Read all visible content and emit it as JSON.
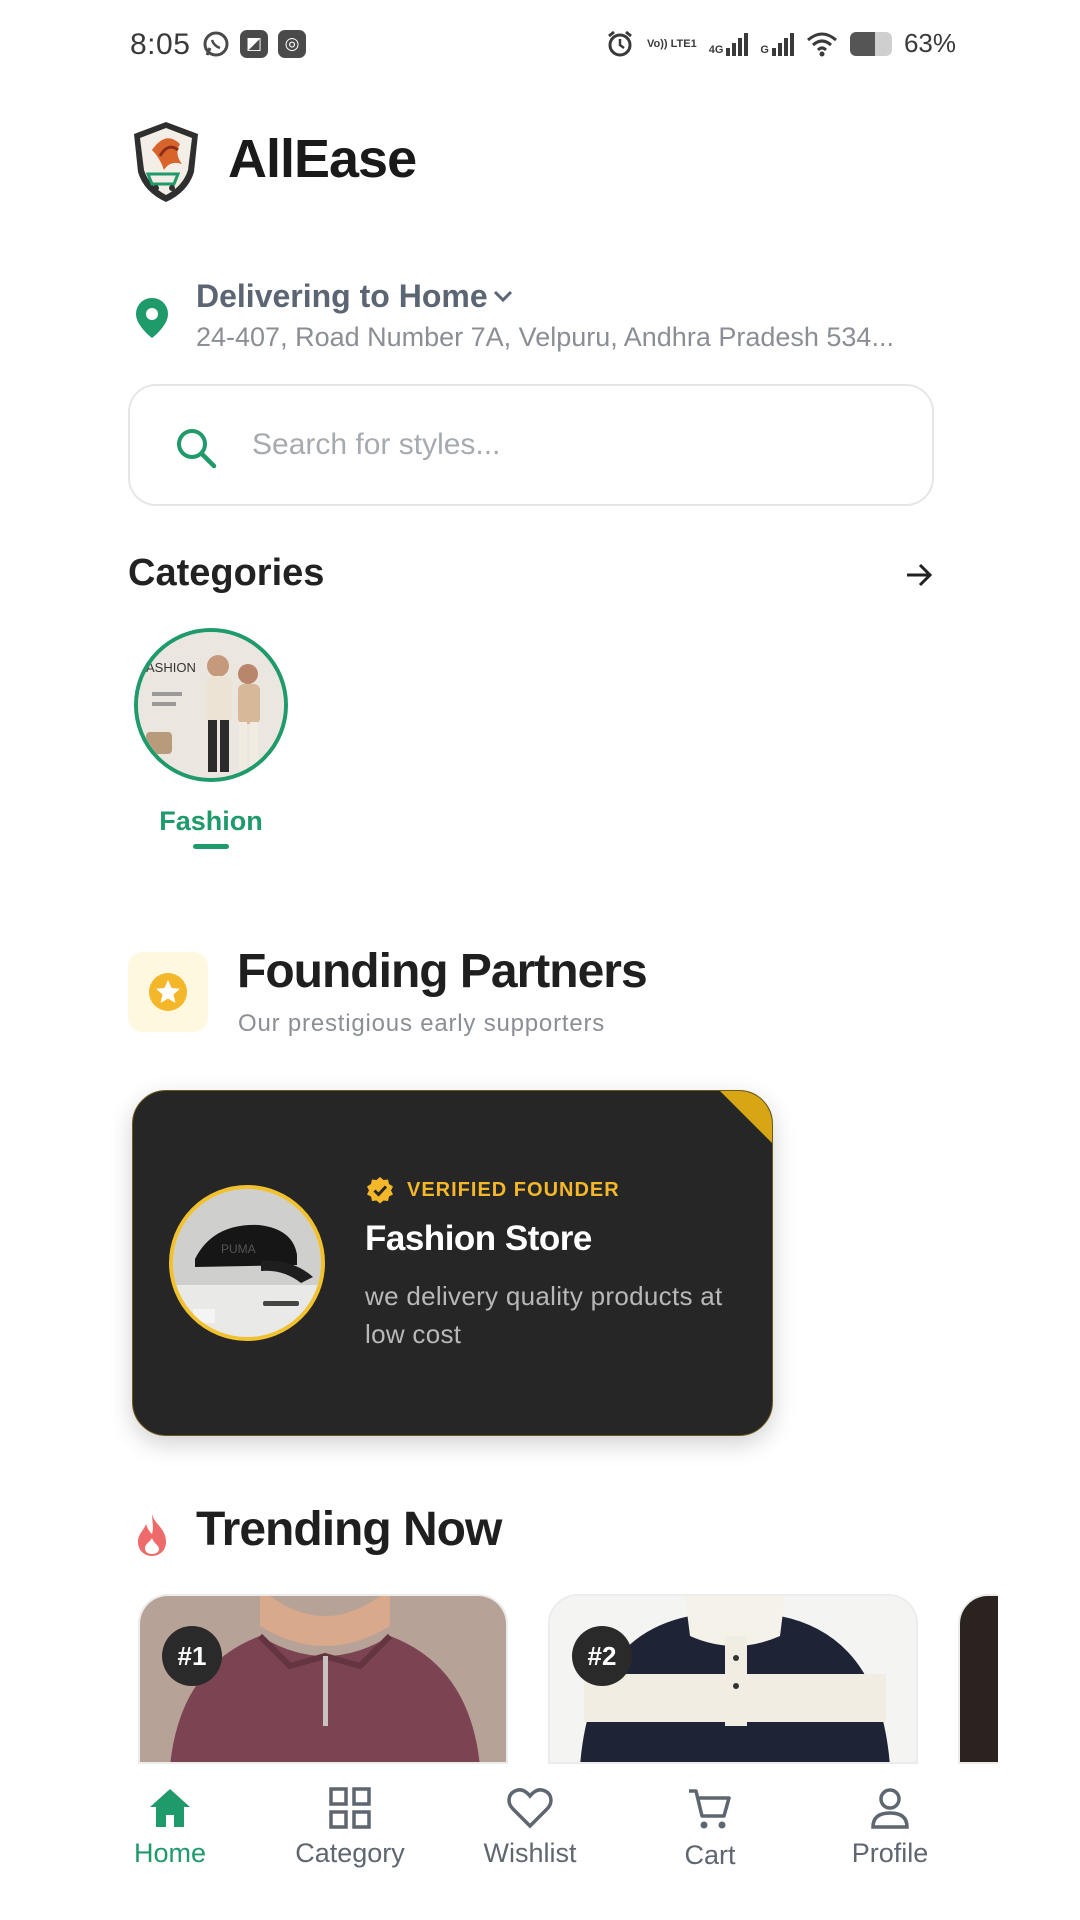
{
  "status_bar": {
    "time": "8:05",
    "battery": "63%",
    "network_labels": [
      "Vo)) LTE1",
      "4G",
      "G"
    ],
    "icons": [
      "whatsapp-icon",
      "app-icon",
      "settings-app-icon",
      "alarm-icon",
      "signal-icon",
      "wifi-icon",
      "battery-icon"
    ]
  },
  "header": {
    "brand": "AllEase",
    "logo_icon": "shield-cart-logo"
  },
  "delivery": {
    "title": "Delivering to Home",
    "address": "24-407, Road Number 7A, Velpuru, Andhra Pradesh 534..."
  },
  "search": {
    "placeholder": "Search for styles...",
    "value": ""
  },
  "categories": {
    "title": "Categories",
    "items": [
      {
        "label": "Fashion",
        "selected": true,
        "image_text": "ASHION"
      }
    ]
  },
  "founding_partners": {
    "title": "Founding Partners",
    "subtitle": "Our prestigious early supporters",
    "cards": [
      {
        "badge": "VERIFIED FOUNDER",
        "name": "Fashion Store",
        "description": "we delivery quality products at low cost",
        "image_text": "PUMA"
      }
    ]
  },
  "trending": {
    "title": "Trending Now",
    "items": [
      {
        "rank": "#1"
      },
      {
        "rank": "#2"
      }
    ]
  },
  "bottom_nav": {
    "items": [
      {
        "label": "Home",
        "icon": "home-icon",
        "active": true
      },
      {
        "label": "Category",
        "icon": "grid-icon",
        "active": false
      },
      {
        "label": "Wishlist",
        "icon": "heart-icon",
        "active": false
      },
      {
        "label": "Cart",
        "icon": "cart-icon",
        "active": false
      },
      {
        "label": "Profile",
        "icon": "person-icon",
        "active": false
      }
    ]
  },
  "colors": {
    "accent": "#1f9a6b",
    "gold": "#f4b72a",
    "card_dark": "#262626",
    "trend_flame": "#ef6b6b"
  }
}
